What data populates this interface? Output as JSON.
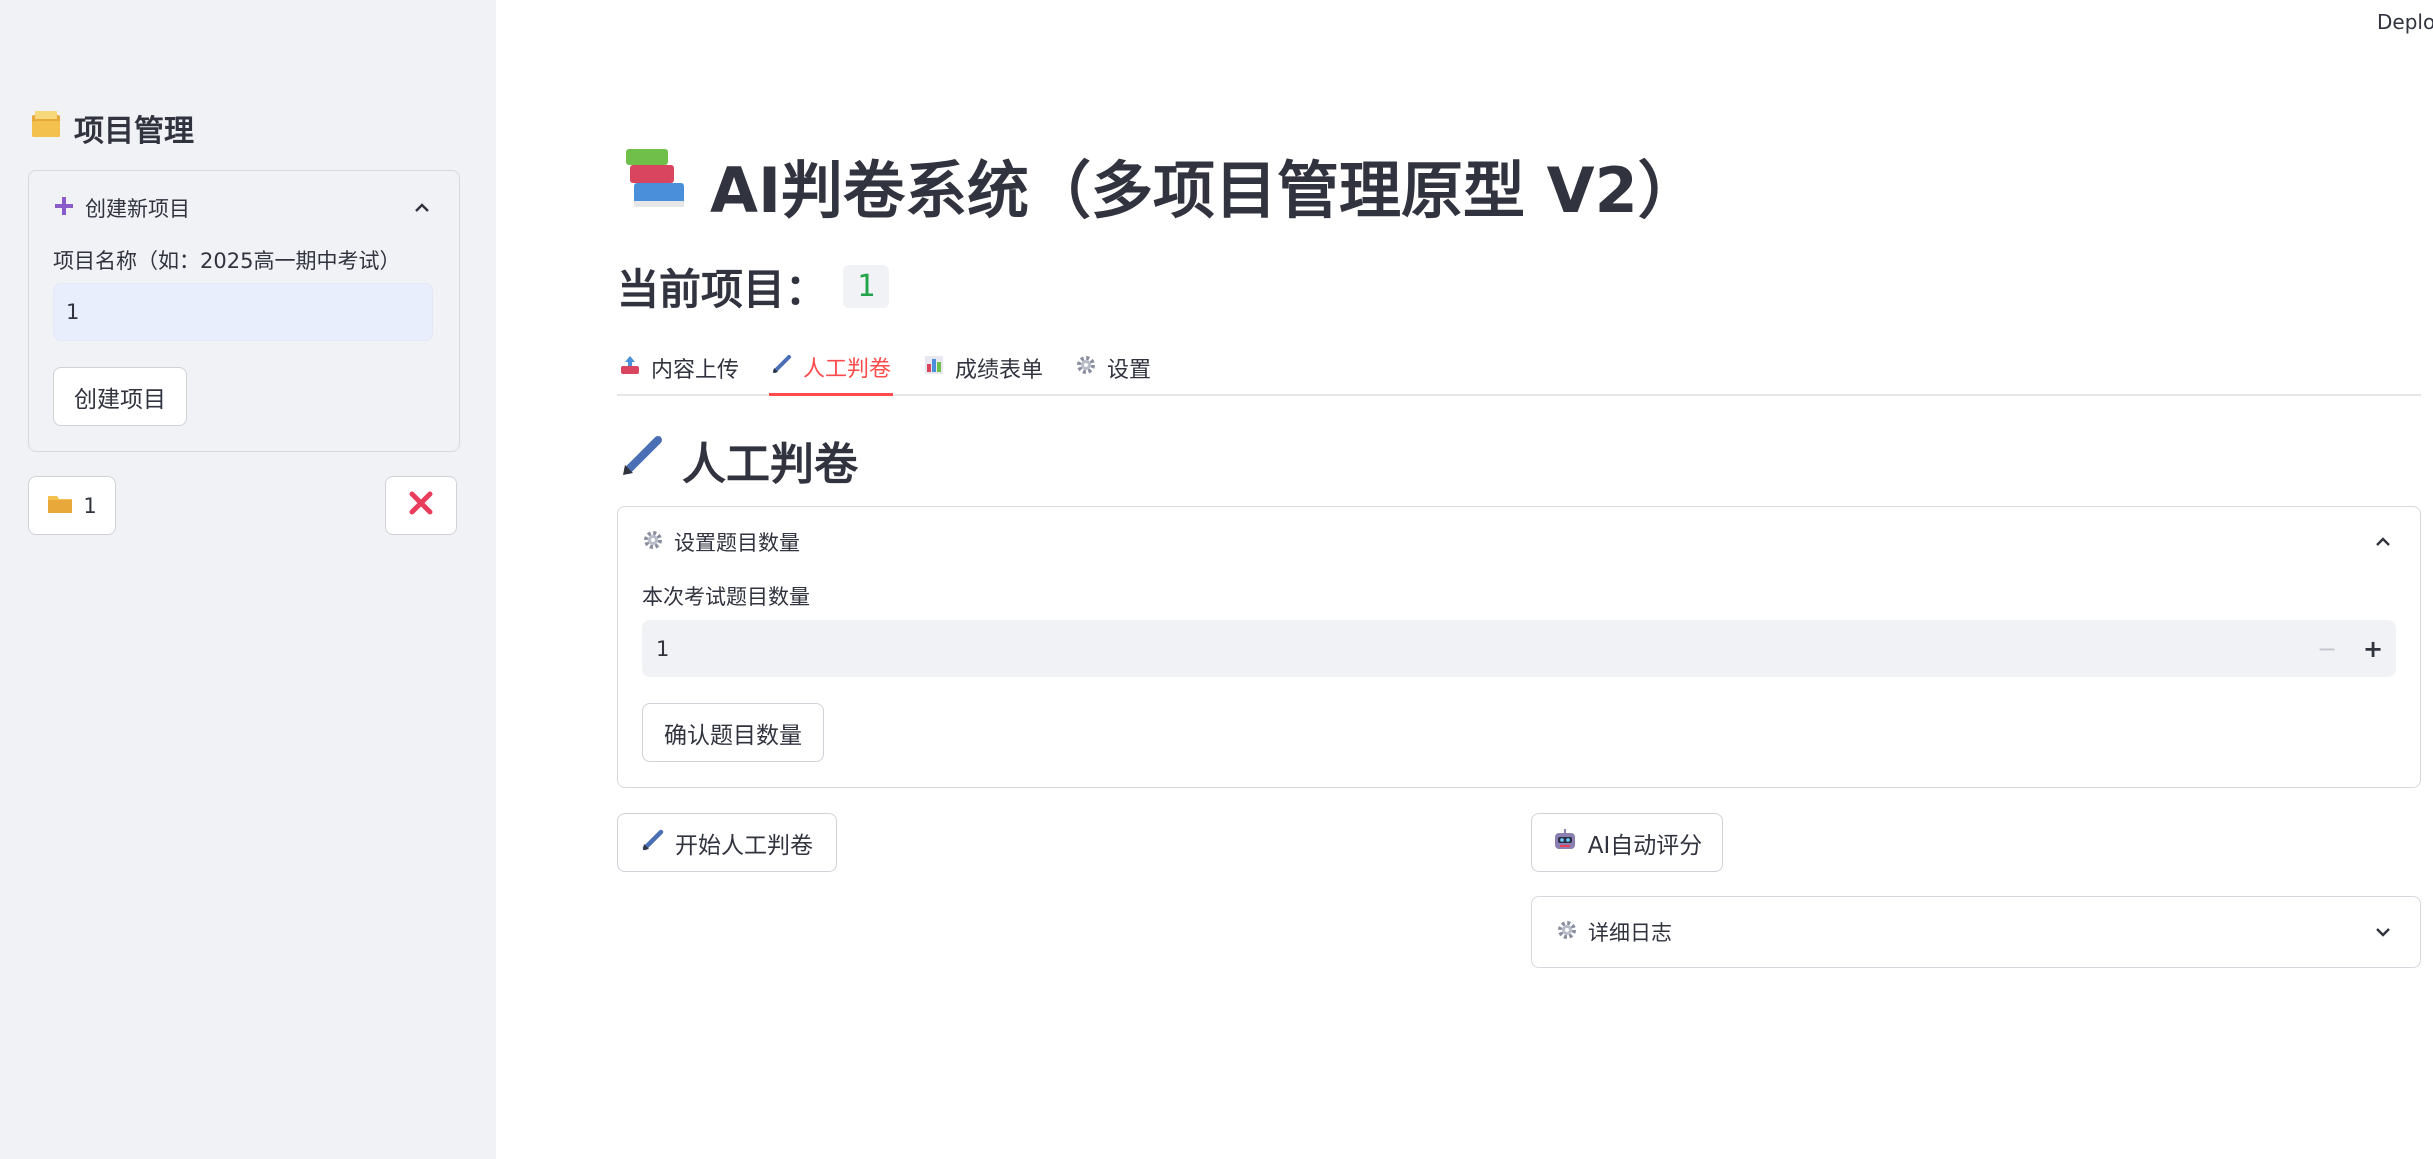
{
  "sidebar": {
    "title": "项目管理",
    "create_expander": {
      "title": "创建新项目",
      "name_label": "项目名称（如：2025高一期中考试）",
      "name_value": "1",
      "create_button": "创建项目"
    },
    "project_button": "1"
  },
  "header": {
    "deploy_label": "Deploy"
  },
  "main": {
    "title": "AI判卷系统（多项目管理原型 V2）",
    "current_project_label": "当前项目：",
    "current_project_value": "1",
    "tabs": [
      {
        "label": "内容上传",
        "icon": "inbox-tray-icon"
      },
      {
        "label": "人工判卷",
        "icon": "pen-icon",
        "active": true
      },
      {
        "label": "成绩表单",
        "icon": "bar-chart-icon"
      },
      {
        "label": "设置",
        "icon": "gear-icon"
      }
    ],
    "section_title": "人工判卷",
    "count_expander": {
      "title": "设置题目数量",
      "field_label": "本次考试题目数量",
      "field_value": "1",
      "confirm_button": "确认题目数量"
    },
    "start_button": "开始人工判卷",
    "ai_button": "AI自动评分",
    "log_expander": {
      "title": "详细日志"
    }
  },
  "colors": {
    "accent": "#ff4b4b",
    "sidebar_bg": "#f0f2f6",
    "code_green": "#21a34a"
  }
}
